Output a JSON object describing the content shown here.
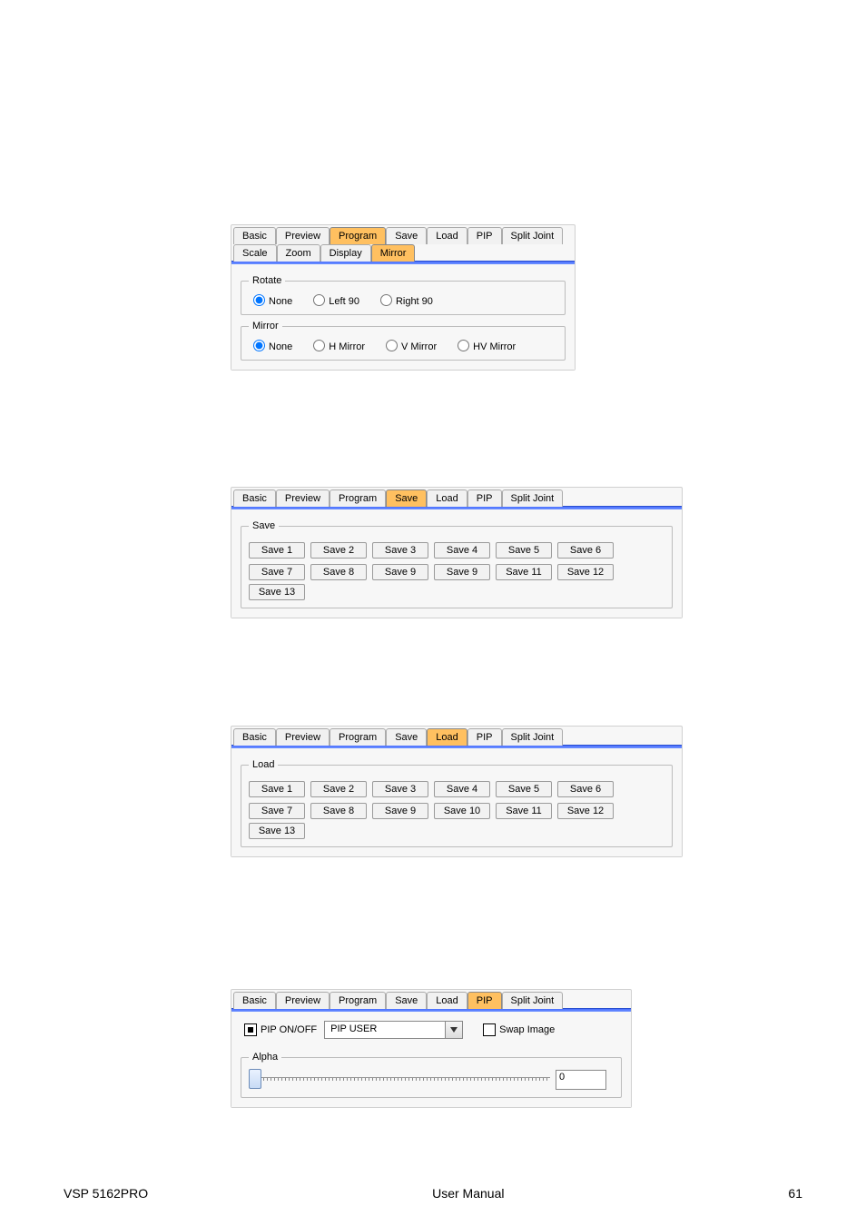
{
  "tabs_row1": [
    "Basic",
    "Preview",
    "Program",
    "Save",
    "Load",
    "PIP",
    "Split Joint"
  ],
  "tabs_row2": [
    "Scale",
    "Zoom",
    "Display",
    "Mirror"
  ],
  "panel1": {
    "activeTop": "Program",
    "activeBottom": "Mirror",
    "rotate": {
      "legend": "Rotate",
      "options": [
        "None",
        "Left 90",
        "Right 90"
      ],
      "selected": "None"
    },
    "mirror": {
      "legend": "Mirror",
      "options": [
        "None",
        "H Mirror",
        "V Mirror",
        "HV Mirror"
      ],
      "selected": "None"
    }
  },
  "panel2": {
    "active": "Save",
    "group": "Save",
    "row1": [
      "Save 1",
      "Save 2",
      "Save 3",
      "Save 4",
      "Save 5",
      "Save 6"
    ],
    "row2": [
      "Save 7",
      "Save 8",
      "Save 9",
      "Save 9",
      "Save 11",
      "Save 12",
      "Save 13"
    ]
  },
  "panel3": {
    "active": "Load",
    "group": "Load",
    "row1": [
      "Save 1",
      "Save 2",
      "Save 3",
      "Save 4",
      "Save 5",
      "Save 6"
    ],
    "row2": [
      "Save 7",
      "Save 8",
      "Save 9",
      "Save 10",
      "Save 11",
      "Save 12",
      "Save 13"
    ]
  },
  "panel4": {
    "active": "PIP",
    "pipOnOff": {
      "label": "PIP ON/OFF",
      "checked": true
    },
    "pipMode": {
      "value": "PIP USER"
    },
    "swap": {
      "label": "Swap Image",
      "checked": false
    },
    "alpha": {
      "legend": "Alpha",
      "value": "0"
    }
  },
  "footer": {
    "left": "VSP 5162PRO",
    "center": "User Manual",
    "right": "61"
  }
}
